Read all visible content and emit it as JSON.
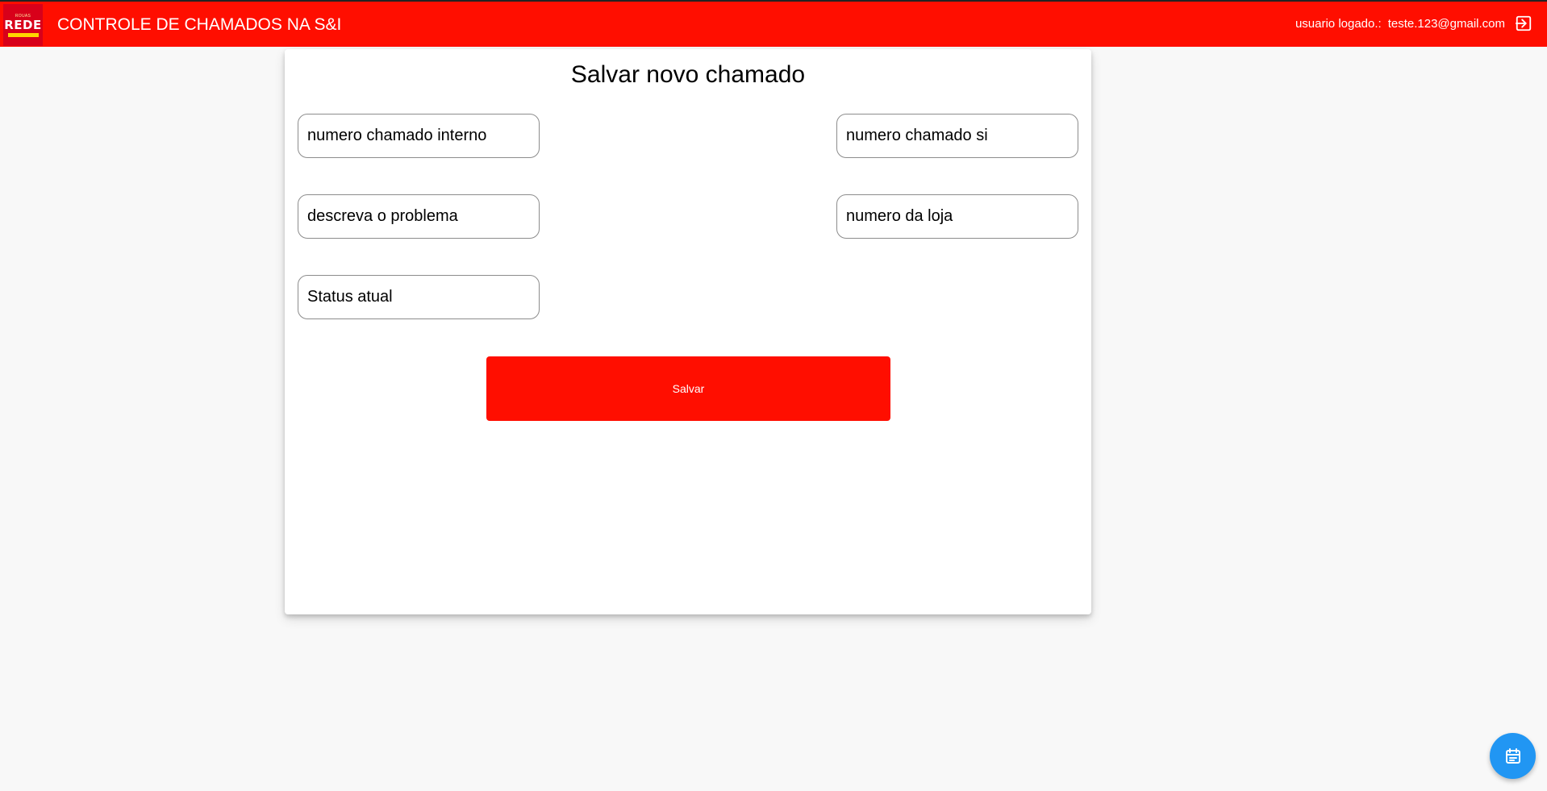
{
  "header": {
    "logo": {
      "small_text": "ROUAS",
      "main_text": "REDE"
    },
    "title": "CONTROLE DE CHAMADOS NA S&I",
    "user_label": "usuario logado.:",
    "user_email": "teste.123@gmail.com",
    "logout_icon": "logout-icon"
  },
  "form": {
    "title": "Salvar novo chamado",
    "fields": {
      "numero_chamado_interno": {
        "placeholder": "numero chamado interno",
        "value": ""
      },
      "numero_chamado_si": {
        "placeholder": "numero chamado si",
        "value": ""
      },
      "descricao_problema": {
        "placeholder": "descreva o problema",
        "value": ""
      },
      "numero_loja": {
        "placeholder": "numero da loja",
        "value": ""
      },
      "status_atual": {
        "placeholder": "Status atual",
        "value": ""
      }
    },
    "save_label": "Salvar"
  },
  "fab": {
    "icon": "calendar-icon"
  },
  "colors": {
    "brand_red": "#ff0e00",
    "fab_blue": "#2196f3",
    "page_background": "#f8f8f8"
  }
}
